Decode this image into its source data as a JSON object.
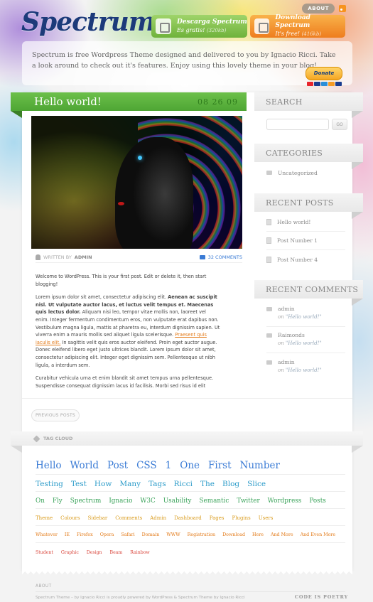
{
  "header": {
    "logo_text": "Spectrum",
    "about_label": "ABOUT",
    "download_spectrum": {
      "title": "Descarga Spectrum",
      "subtitle": "Es gratis!",
      "size": "(320kb)"
    },
    "download_en": {
      "title": "Download Spectrum",
      "subtitle": "It's free!",
      "size": "(416kb)"
    }
  },
  "intro": {
    "text": "Spectrum is free Wordpress Theme designed and delivered to you by Ignacio Ricci. Take a look around to check out it's features. Enjoy using this lovely theme in your blog!",
    "donate_label": "Donate"
  },
  "post": {
    "title": "Hello world!",
    "date": "08 26 09",
    "written_by_label": "WRITTEN BY",
    "author": "ADMIN",
    "comments_label": "32 COMMENTS",
    "para1": "Welcome to WordPress. This is your first post. Edit or delete it, then start blogging!",
    "para2_a": "Lorem ipsum dolor sit amet, consectetur adipiscing elit. ",
    "para2_bold": "Aenean ac suscipit nisl. Ut vulputate auctor lacus, et luctus velit tempus et. Maecenas quis lectus dolor.",
    "para2_b": " Aliquam nisi leo, tempor vitae mollis non, laoreet vel enim. Integer fermentum condimentum eros, non vulputate erat dapibus non. Vestibulum magna ligula, mattis at pharetra eu, interdum dignissim sapien. Ut viverra enim a mauris mollis sed aliquet ligula scelerisque. ",
    "para2_link": "Praesent quis iaculis elit.",
    "para2_c": " In sagittis velit quis eros auctor eleifend. Proin eget auctor augue. Donec eleifend libero eget justo ultrices blandit. Lorem ipsum dolor sit amet, consectetur adipiscing elit. Integer eget dignissim sem. Pellentesque ut nibh ligula, a interdum sem.",
    "para3": "Curabitur vehicula urna et enim blandit sit amet tempus urna pellentesque. Suspendisse consequat dignissim lacus id facilisis. Morbi sed risus id elit"
  },
  "nav": {
    "previous_posts": "PREVIOUS POSTS"
  },
  "tag_cloud": {
    "label": "TAG CLOUD",
    "row1": [
      "Hello",
      "World",
      "Post",
      "CSS",
      "1",
      "One",
      "First",
      "Number"
    ],
    "row2": [
      "Testing",
      "Test",
      "How",
      "Many",
      "Tags",
      "Ricci",
      "The",
      "Blog",
      "Slice"
    ],
    "row3": [
      "On",
      "Fly",
      "Spectrum",
      "Ignacio",
      "W3C",
      "Usability",
      "Semantic",
      "Twitter",
      "Wordpress",
      "Posts"
    ],
    "row4": [
      "Theme",
      "Colours",
      "Sidebar",
      "Comments",
      "Admin",
      "Dashboard",
      "Pages",
      "Plugins",
      "Users"
    ],
    "row5": [
      "Whatever",
      "IE",
      "Firefox",
      "Opera",
      "Safari",
      "Domain",
      "WWW",
      "Registration",
      "Download",
      "Here",
      "And More",
      "And Even More"
    ],
    "row6": [
      "Student",
      "Graphic",
      "Design",
      "Beam",
      "Rainbow"
    ]
  },
  "sidebar": {
    "search_title": "SEARCH",
    "search_placeholder": "",
    "search_button": "GO",
    "categories_title": "CATEGORIES",
    "categories": [
      "Uncategorized"
    ],
    "recent_posts_title": "RECENT POSTS",
    "recent_posts": [
      "Hello world!",
      "Post Number 1",
      "Post Number 4"
    ],
    "recent_comments_title": "RECENT COMMENTS",
    "recent_comments": [
      {
        "author": "admin",
        "on": "on",
        "post": "\"Hello world!\""
      },
      {
        "author": "Raimonds",
        "on": "on",
        "post": "\"Hello world!\""
      },
      {
        "author": "admin",
        "on": "on",
        "post": "\"Hello world!\""
      }
    ]
  },
  "footer": {
    "about": "ABOUT",
    "credits": "Spectrum Theme – by Ignacio Ricci is proudly powered by WordPress & Spectrum Theme by Ignacio Ricci",
    "tagline": "CODE IS POETRY"
  },
  "colors": {
    "green_bar": "#5cb33e",
    "link_blue": "#3a7bd5",
    "link_orange": "#e37b1a"
  }
}
